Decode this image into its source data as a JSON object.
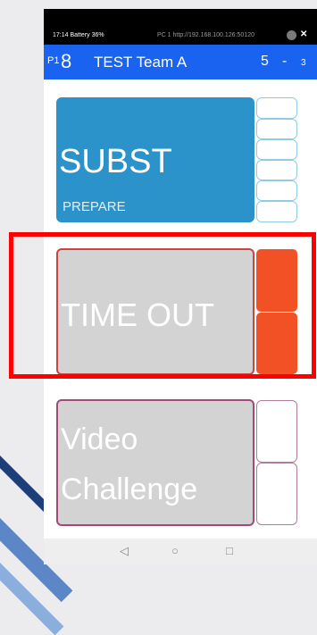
{
  "status_bar": {
    "time_battery": "17:14 Battery 36%",
    "url": "PC 1 http://192.168.100.126:50120",
    "close_icon": "close-icon"
  },
  "header": {
    "set_label": "P1",
    "team_number": "8",
    "team_name": "TEST Team A",
    "score": "5",
    "score_separator": "-",
    "score_small": "3"
  },
  "subst": {
    "title": "SUBST",
    "subtitle": "PREPARE",
    "color": "#2b93c9"
  },
  "timeout": {
    "title": "TIME OUT",
    "slot_color": "#f25125"
  },
  "video": {
    "line1": "Video",
    "line2": "Challenge"
  },
  "navbar": {
    "back_icon": "◁",
    "home_icon": "○",
    "recents_icon": "□"
  },
  "highlight_color": "#ff0000"
}
